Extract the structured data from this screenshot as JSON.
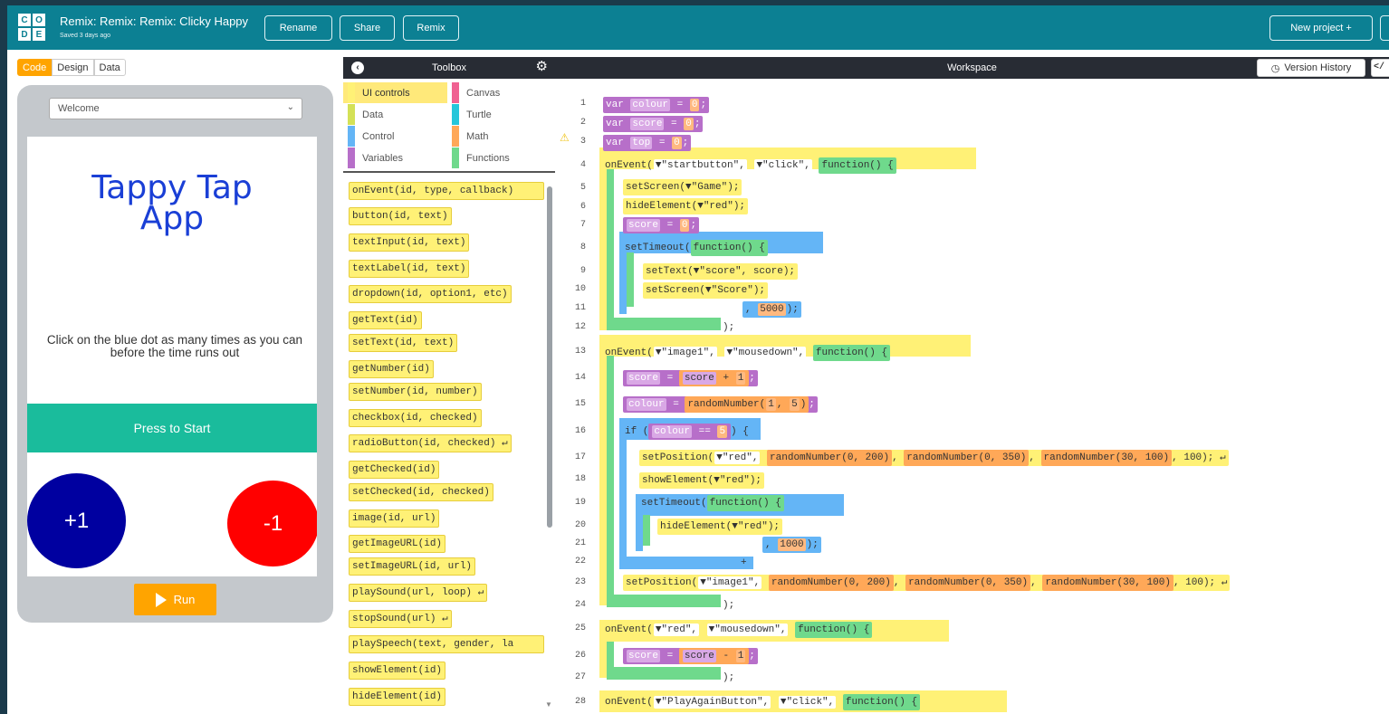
{
  "header": {
    "logo_letters": [
      "C",
      "O",
      "D",
      "E"
    ],
    "project_title": "Remix: Remix: Remix: Clicky Happy",
    "saved_text": "Saved 3 days ago",
    "rename_label": "Rename",
    "share_label": "Share",
    "remix_label": "Remix",
    "new_project_label": "New project +"
  },
  "mode_tabs": [
    "Code",
    "Design",
    "Data"
  ],
  "app_preview": {
    "screen_select": "Welcome",
    "title": "Tappy Tap App",
    "instructions": "Click on the blue dot as many times as you can before the time runs out",
    "start_button": "Press to Start",
    "blue_dot_label": "+1",
    "red_dot_label": "-1",
    "run_label": "Run"
  },
  "toolbox": {
    "title": "Toolbox",
    "categories": [
      {
        "label": "UI controls",
        "color": "#fff176"
      },
      {
        "label": "Canvas",
        "color": "#f06292"
      },
      {
        "label": "Data",
        "color": "#d4e157"
      },
      {
        "label": "Turtle",
        "color": "#26c6da"
      },
      {
        "label": "Control",
        "color": "#64b5f6"
      },
      {
        "label": "Math",
        "color": "#ffa858"
      },
      {
        "label": "Variables",
        "color": "#b76fc9"
      },
      {
        "label": "Functions",
        "color": "#6fd98c"
      }
    ],
    "blocks": [
      "onEvent(id, type, callback)",
      "button(id, text)",
      "textInput(id, text)",
      "textLabel(id, text)",
      "dropdown(id, option1, etc)",
      "getText(id)",
      "setText(id, text)",
      "getNumber(id)",
      "setNumber(id, number)",
      "checkbox(id, checked)",
      "radioButton(id, checked) ↵",
      "getChecked(id)",
      "setChecked(id, checked)",
      "image(id, url)",
      "getImageURL(id)",
      "setImageURL(id, url)",
      "playSound(url, loop) ↵",
      "stopSound(url) ↵",
      "playSpeech(text, gender, la",
      "showElement(id)",
      "hideElement(id)"
    ]
  },
  "workspace": {
    "title": "Workspace",
    "version_history_label": "Version History",
    "code_toggle_label": "</",
    "line_numbers": [
      "1",
      "2",
      "3",
      "4",
      "5",
      "6",
      "7",
      "8",
      "9",
      "10",
      "11",
      "12",
      "13",
      "14",
      "15",
      "16",
      "17",
      "18",
      "19",
      "20",
      "21",
      "22",
      "23",
      "24",
      "25",
      "26",
      "27",
      "28"
    ],
    "code": {
      "l1": {
        "kw": "var",
        "name": "colour",
        "eq": "=",
        "val": "0",
        "end": ";"
      },
      "l2": {
        "kw": "var",
        "name": "score",
        "eq": "=",
        "val": "0",
        "end": ";"
      },
      "l3": {
        "kw": "var",
        "name": "top",
        "eq": "=",
        "val": "0",
        "end": ";"
      },
      "l4": {
        "fn": "onEvent(",
        "a1": "▼\"startbutton\",",
        "a2": "▼\"click\",",
        "func": "function() {"
      },
      "l5": "setScreen(▼\"Game\");",
      "l6": "hideElement(▼\"red\");",
      "l7": {
        "name": "score",
        "eq": "=",
        "val": "0",
        "end": ";"
      },
      "l8": {
        "fn": "setTimeout(",
        "func": "function() {"
      },
      "l9": "setText(▼\"score\", score);",
      "l10": "setScreen(▼\"Score\");",
      "l11": {
        "pre": ",",
        "val": "5000",
        "end": ");"
      },
      "l12": ");",
      "l13": {
        "fn": "onEvent(",
        "a1": "▼\"image1\",",
        "a2": "▼\"mousedown\",",
        "func": "function() {"
      },
      "l14": {
        "name": "score",
        "eq": "=",
        "ref": "score",
        "op": "+",
        "num": "1",
        "end": ";"
      },
      "l15": {
        "name": "colour",
        "eq": "=",
        "fn": "randomNumber(",
        "a": "1",
        "b": "5",
        "close": ")",
        "end": ";"
      },
      "l16": {
        "kw": "if (",
        "name": "colour",
        "op": "==",
        "num": "5",
        "close": ")",
        "brace": "{"
      },
      "l17": {
        "fn": "setPosition(",
        "a1": "▼\"red\",",
        "r1": "randomNumber(0, 200)",
        "r2": "randomNumber(0, 350)",
        "r3": "randomNumber(30, 100)",
        "tail": ", 100); ↵"
      },
      "l18": "showElement(▼\"red\");",
      "l19": {
        "fn": "setTimeout(",
        "func": "function() {"
      },
      "l20": "hideElement(▼\"red\");",
      "l21": {
        "pre": ",",
        "val": "1000",
        "end": ");"
      },
      "l22": "+",
      "l23": {
        "fn": "setPosition(",
        "a1": "▼\"image1\",",
        "r1": "randomNumber(0, 200)",
        "r2": "randomNumber(0, 350)",
        "r3": "randomNumber(30, 100)",
        "tail": ", 100); ↵"
      },
      "l24": ");",
      "l25": {
        "fn": "onEvent(",
        "a1": "▼\"red\",",
        "a2": "▼\"mousedown\",",
        "func": "function() {"
      },
      "l26": {
        "name": "score",
        "eq": "=",
        "ref": "score",
        "op": "-",
        "num": "1",
        "end": ";"
      },
      "l27": ");",
      "l28": {
        "fn": "onEvent(",
        "a1": "▼\"PlayAgainButton\",",
        "a2": "▼\"click\",",
        "func": "function() {"
      }
    }
  },
  "colors": {
    "header_bg": "#0c8093",
    "toolbar_dark": "#282c34",
    "run_orange": "#ffa400",
    "start_green": "#1abc9c",
    "blue_dot": "#0000a0",
    "red_dot": "#ff0000"
  }
}
